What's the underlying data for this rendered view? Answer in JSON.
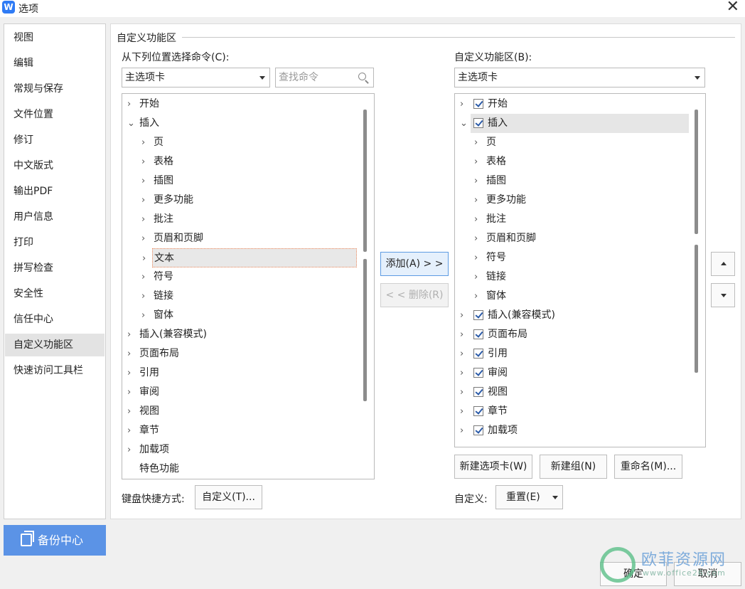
{
  "window": {
    "title": "选项",
    "app_icon": "W"
  },
  "sidebar": {
    "items": [
      {
        "label": "视图"
      },
      {
        "label": "编辑"
      },
      {
        "label": "常规与保存"
      },
      {
        "label": "文件位置"
      },
      {
        "label": "修订"
      },
      {
        "label": "中文版式"
      },
      {
        "label": "输出PDF"
      },
      {
        "label": "用户信息"
      },
      {
        "label": "打印"
      },
      {
        "label": "拼写检查"
      },
      {
        "label": "安全性"
      },
      {
        "label": "信任中心"
      },
      {
        "label": "自定义功能区"
      },
      {
        "label": "快速访问工具栏"
      }
    ],
    "active": "自定义功能区"
  },
  "backup": {
    "label": "备份中心"
  },
  "main": {
    "section_title": "自定义功能区",
    "left": {
      "choose_label": "从下列位置选择命令(C):",
      "dropdown_value": "主选项卡",
      "search_placeholder": "查找命令",
      "tree": [
        {
          "label": "开始",
          "level": 0,
          "arrow": "›"
        },
        {
          "label": "插入",
          "level": 0,
          "arrow": "⌄"
        },
        {
          "label": "页",
          "level": 1,
          "arrow": "›"
        },
        {
          "label": "表格",
          "level": 1,
          "arrow": "›"
        },
        {
          "label": "插图",
          "level": 1,
          "arrow": "›"
        },
        {
          "label": "更多功能",
          "level": 1,
          "arrow": "›"
        },
        {
          "label": "批注",
          "level": 1,
          "arrow": "›"
        },
        {
          "label": "页眉和页脚",
          "level": 1,
          "arrow": "›"
        },
        {
          "label": "文本",
          "level": 1,
          "arrow": "›",
          "selected": true
        },
        {
          "label": "符号",
          "level": 1,
          "arrow": "›"
        },
        {
          "label": "链接",
          "level": 1,
          "arrow": "›"
        },
        {
          "label": "窗体",
          "level": 1,
          "arrow": "›"
        },
        {
          "label": "插入(兼容模式)",
          "level": 0,
          "arrow": "›"
        },
        {
          "label": "页面布局",
          "level": 0,
          "arrow": "›"
        },
        {
          "label": "引用",
          "level": 0,
          "arrow": "›"
        },
        {
          "label": "审阅",
          "level": 0,
          "arrow": "›"
        },
        {
          "label": "视图",
          "level": 0,
          "arrow": "›"
        },
        {
          "label": "章节",
          "level": 0,
          "arrow": "›"
        },
        {
          "label": "加载项",
          "level": 0,
          "arrow": "›"
        },
        {
          "label": "特色功能",
          "level": 0,
          "arrow": ""
        }
      ],
      "keyboard_label": "键盘快捷方式:",
      "customize_button": "自定义(T)..."
    },
    "middle": {
      "add_button": "添加(A) > >",
      "remove_button": "< < 删除(R)"
    },
    "right": {
      "customize_label": "自定义功能区(B):",
      "dropdown_value": "主选项卡",
      "tree": [
        {
          "label": "开始",
          "level": 0,
          "arrow": "›",
          "checked": true
        },
        {
          "label": "插入",
          "level": 0,
          "arrow": "⌄",
          "checked": true,
          "selected": true
        },
        {
          "label": "页",
          "level": 1,
          "arrow": "›"
        },
        {
          "label": "表格",
          "level": 1,
          "arrow": "›"
        },
        {
          "label": "插图",
          "level": 1,
          "arrow": "›"
        },
        {
          "label": "更多功能",
          "level": 1,
          "arrow": "›"
        },
        {
          "label": "批注",
          "level": 1,
          "arrow": "›"
        },
        {
          "label": "页眉和页脚",
          "level": 1,
          "arrow": "›"
        },
        {
          "label": "符号",
          "level": 1,
          "arrow": "›"
        },
        {
          "label": "链接",
          "level": 1,
          "arrow": "›"
        },
        {
          "label": "窗体",
          "level": 1,
          "arrow": "›"
        },
        {
          "label": "插入(兼容模式)",
          "level": 0,
          "arrow": "›",
          "checked": true
        },
        {
          "label": "页面布局",
          "level": 0,
          "arrow": "›",
          "checked": true
        },
        {
          "label": "引用",
          "level": 0,
          "arrow": "›",
          "checked": true
        },
        {
          "label": "审阅",
          "level": 0,
          "arrow": "›",
          "checked": true
        },
        {
          "label": "视图",
          "level": 0,
          "arrow": "›",
          "checked": true
        },
        {
          "label": "章节",
          "level": 0,
          "arrow": "›",
          "checked": true
        },
        {
          "label": "加载项",
          "level": 0,
          "arrow": "›",
          "checked": true
        }
      ],
      "new_tab_button": "新建选项卡(W)",
      "new_group_button": "新建组(N)",
      "rename_button": "重命名(M)...",
      "customize_label2": "自定义:",
      "reset_button": "重置(E)"
    }
  },
  "footer": {
    "ok_button": "确定",
    "cancel_button": "取消"
  },
  "watermark": {
    "text": "欧菲资源网",
    "sub": "www.office26.com"
  },
  "colors": {
    "accent": "#5b93e6",
    "selected_border": "#f08a5d",
    "check": "#2a5aa8"
  }
}
